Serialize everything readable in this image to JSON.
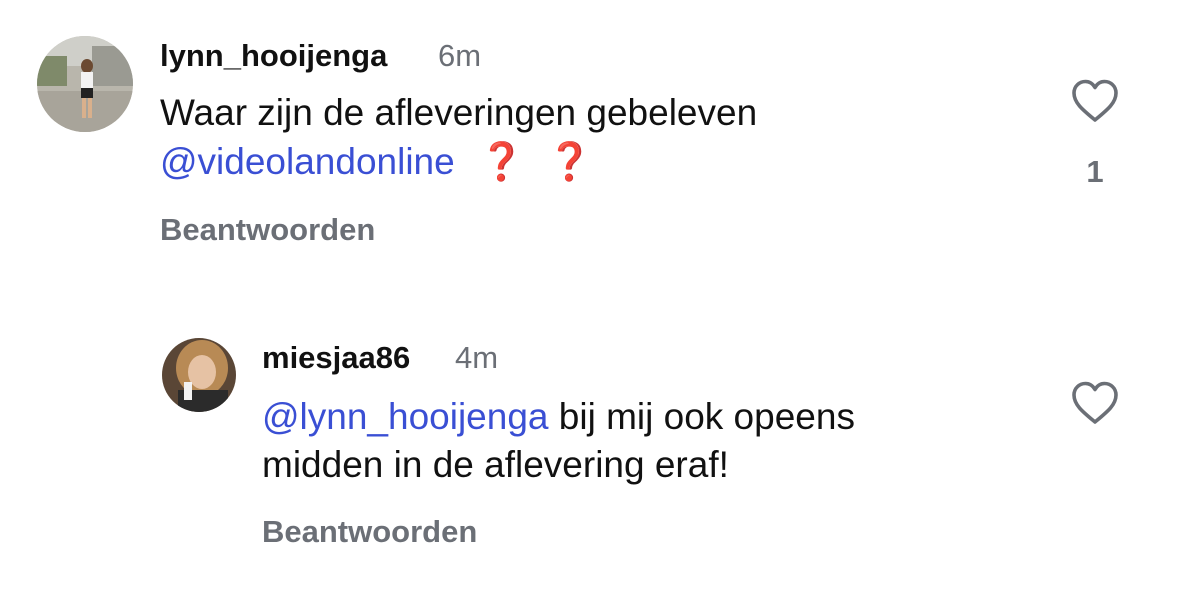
{
  "comments": [
    {
      "username": "lynn_hooijenga",
      "time": "6m",
      "text_line1": "Waar zijn de afleveringen gebeleven",
      "mention": "@videolandonline",
      "emoji1": "❓",
      "emoji2": "❓",
      "reply_label": "Beantwoorden",
      "like_count": "1",
      "avatar_icon": "profile-photo"
    },
    {
      "username": "miesjaa86",
      "time": "4m",
      "mention": "@lynn_hooijenga",
      "text_line1_rest": " bij mij ook opeens",
      "text_line2": "midden in de aflevering eraf!",
      "reply_label": "Beantwoorden",
      "avatar_icon": "profile-photo"
    }
  ],
  "colors": {
    "mention": "#3a4fd4",
    "secondary_text": "#6b6f76",
    "question_mark": "#e3131b"
  }
}
